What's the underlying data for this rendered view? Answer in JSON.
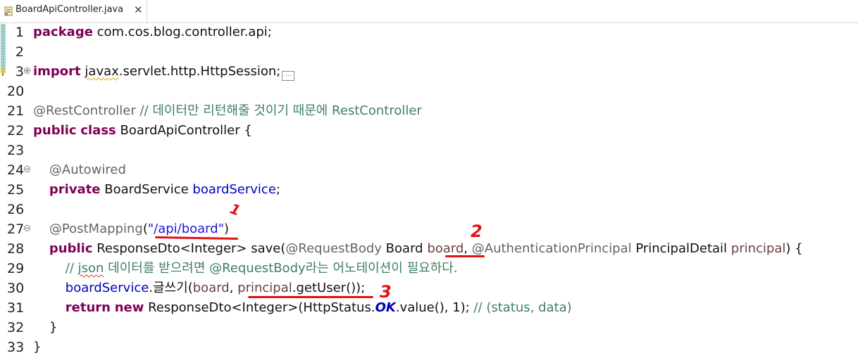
{
  "tab": {
    "title": "BoardApiController.java",
    "close": "✕",
    "icon": "java-file-icon"
  },
  "lines": [
    {
      "no": "1",
      "parts": [
        [
          "kw",
          "package"
        ],
        [
          "t",
          " com.cos.blog.controller.api;"
        ]
      ]
    },
    {
      "no": "2",
      "parts": []
    },
    {
      "no": "3",
      "parts": [
        [
          "kw",
          "import"
        ],
        [
          "t",
          " "
        ],
        [
          "sq",
          "javax"
        ],
        [
          "t",
          ".servlet.http.HttpSession;"
        ],
        [
          "ell",
          "..."
        ]
      ]
    },
    {
      "no": "20",
      "parts": []
    },
    {
      "no": "21",
      "parts": [
        [
          "ann",
          "@RestController"
        ],
        [
          "t",
          " "
        ],
        [
          "cmt",
          "// 데이터만 리턴해줄 것이기 때문에 RestController"
        ]
      ]
    },
    {
      "no": "22",
      "parts": [
        [
          "kw",
          "public"
        ],
        [
          "t",
          " "
        ],
        [
          "kw",
          "class"
        ],
        [
          "t",
          " BoardApiController {"
        ]
      ]
    },
    {
      "no": "23",
      "parts": []
    },
    {
      "no": "24",
      "parts": [
        [
          "t",
          "    "
        ],
        [
          "ann",
          "@Autowired"
        ]
      ]
    },
    {
      "no": "25",
      "parts": [
        [
          "t",
          "    "
        ],
        [
          "kw",
          "private"
        ],
        [
          "t",
          " BoardService "
        ],
        [
          "fld",
          "boardService"
        ],
        [
          "t",
          ";"
        ]
      ]
    },
    {
      "no": "26",
      "parts": []
    },
    {
      "no": "27",
      "parts": [
        [
          "t",
          "    "
        ],
        [
          "ann",
          "@PostMapping"
        ],
        [
          "t",
          "("
        ],
        [
          "str",
          "\"/api/board\""
        ],
        [
          "t",
          ")"
        ]
      ]
    },
    {
      "no": "28",
      "parts": [
        [
          "t",
          "    "
        ],
        [
          "kw",
          "public"
        ],
        [
          "t",
          " ResponseDto<Integer> save("
        ],
        [
          "ann",
          "@RequestBody"
        ],
        [
          "t",
          " Board "
        ],
        [
          "param",
          "board"
        ],
        [
          "t",
          ", "
        ],
        [
          "ann",
          "@AuthenticationPrincipal"
        ],
        [
          "t",
          " PrincipalDetail "
        ],
        [
          "param",
          "principal"
        ],
        [
          "t",
          ") {"
        ]
      ]
    },
    {
      "no": "29",
      "parts": [
        [
          "t",
          "        "
        ],
        [
          "cmt",
          "// "
        ],
        [
          "cmtsq",
          "json"
        ],
        [
          "cmt",
          " 데이터를 받으려면 @RequestBody라는 어노테이션이 필요하다."
        ]
      ]
    },
    {
      "no": "30",
      "parts": [
        [
          "t",
          "        "
        ],
        [
          "fld",
          "boardService"
        ],
        [
          "t",
          ".글쓰기("
        ],
        [
          "param",
          "board"
        ],
        [
          "t",
          ", "
        ],
        [
          "param",
          "principal"
        ],
        [
          "t",
          ".getUser());"
        ]
      ]
    },
    {
      "no": "31",
      "parts": [
        [
          "t",
          "        "
        ],
        [
          "kw",
          "return"
        ],
        [
          "t",
          " "
        ],
        [
          "kw",
          "new"
        ],
        [
          "t",
          " ResponseDto<Integer>(HttpStatus."
        ],
        [
          "const",
          "OK"
        ],
        [
          "t",
          ".value(), 1); "
        ],
        [
          "cmt",
          "// (status, data)"
        ]
      ]
    },
    {
      "no": "32",
      "parts": [
        [
          "t",
          "    }"
        ]
      ]
    },
    {
      "no": "33",
      "parts": [
        [
          "t",
          "}"
        ]
      ]
    }
  ],
  "annotations": {
    "mark1": "1",
    "mark2": "2",
    "mark3": "3"
  },
  "colors": {
    "keyword": "#7f0055",
    "string": "#1a1ad6",
    "comment": "#3f7f5f",
    "annotation": "#646464",
    "field": "#0000c0",
    "marker": "#e21212"
  }
}
